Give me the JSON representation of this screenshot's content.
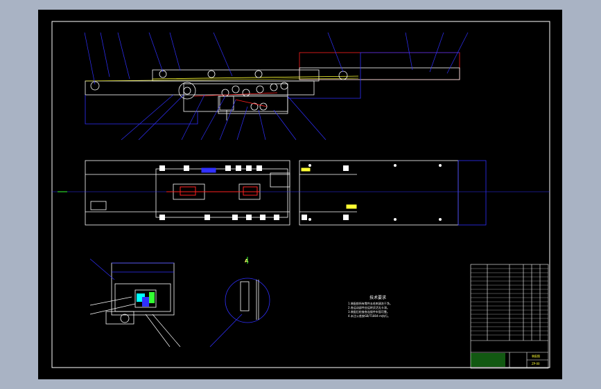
{
  "canvas": {
    "background_color": "#a9b3c4",
    "paper_color": "#000000",
    "line_color": "#ffffff",
    "leader_color": "#3030ff",
    "accent_colors": [
      "#ff2020",
      "#ffff33",
      "#33ff33",
      "#00ffff"
    ]
  },
  "technical_requirements": {
    "title": "技术要求",
    "items": [
      "1.装配前所有零件去毛刺清洗干净。",
      "2.各运动部件应运转灵活无卡滞。",
      "3.装配后检查各连接件牢固可靠。",
      "4.未注公差按GB/T1804-m执行。"
    ]
  },
  "section_label": "A",
  "title_block": {
    "drawing_name": "装配图",
    "drawing_number": "ZP-00"
  }
}
